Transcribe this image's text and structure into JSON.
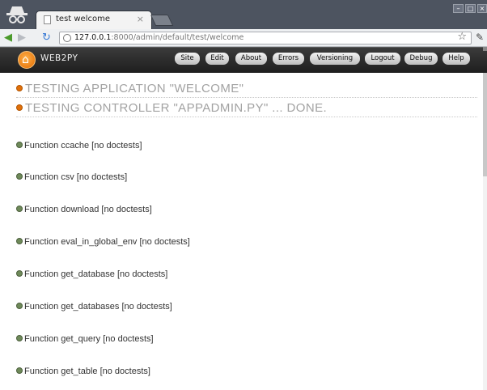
{
  "browser": {
    "tab_title": "test welcome",
    "tab_close": "×",
    "url_host": "127.0.0.1",
    "url_rest": ":8000/admin/default/test/welcome"
  },
  "app": {
    "brand": "WEB2PY",
    "nav": [
      "Site",
      "Edit",
      "About",
      "Errors",
      "Versioning",
      "Logout",
      "Debug",
      "Help"
    ]
  },
  "headings": [
    "TESTING APPLICATION \"WELCOME\"",
    "TESTING CONTROLLER \"APPADMIN.PY\" ... DONE."
  ],
  "functions": [
    "Function ccache [no doctests]",
    "Function csv [no doctests]",
    "Function download [no doctests]",
    "Function eval_in_global_env [no doctests]",
    "Function get_database [no doctests]",
    "Function get_databases [no doctests]",
    "Function get_query [no doctests]",
    "Function get_table [no doctests]"
  ],
  "colors": {
    "accent": "#e0700a",
    "bar": "#2a2a2a",
    "heading": "#a2a2a2"
  }
}
